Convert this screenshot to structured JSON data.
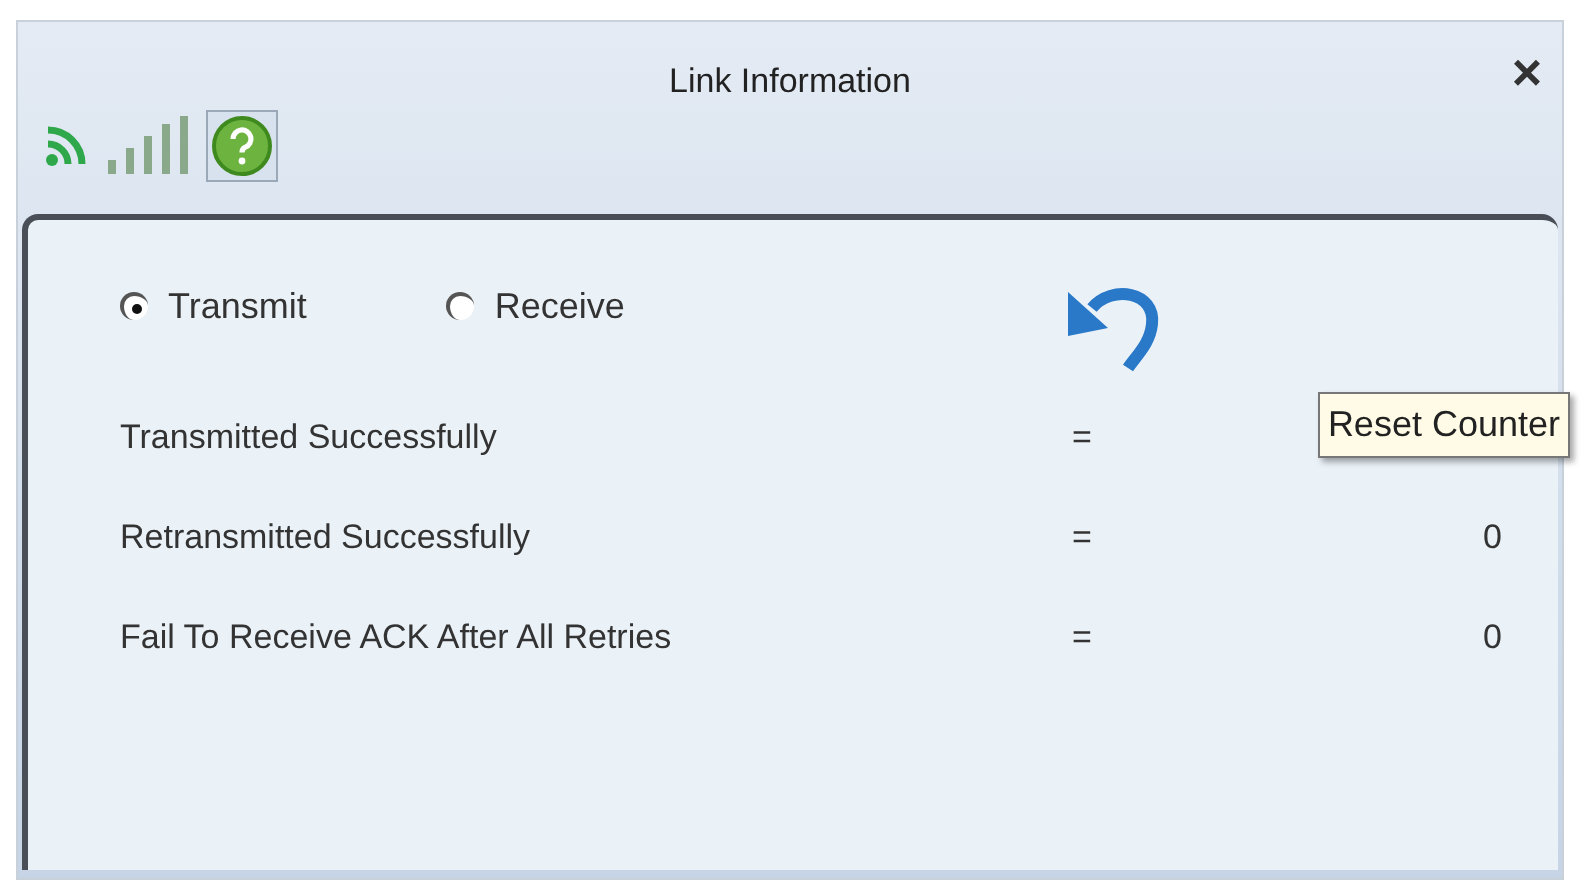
{
  "window": {
    "title": "Link Information",
    "close": "×"
  },
  "modes": [
    {
      "label": "Transmit",
      "selected": true
    },
    {
      "label": "Receive",
      "selected": false
    }
  ],
  "tooltip": "Reset Counter",
  "stats": [
    {
      "label": "Transmitted Successfully",
      "sign": "="
    },
    {
      "label": "Retransmitted Successfully",
      "sign": "=",
      "value": "0"
    },
    {
      "label": "Fail To Receive ACK After All Retries",
      "sign": "=",
      "value": "0"
    }
  ]
}
